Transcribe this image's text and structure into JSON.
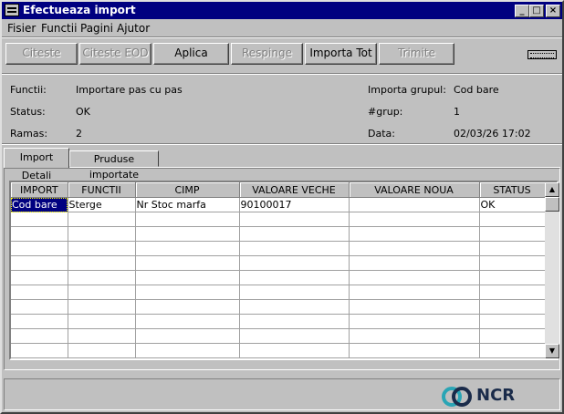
{
  "window": {
    "title": "Efectueaza import",
    "controls": [
      "_",
      "□",
      "×"
    ]
  },
  "menu": [
    {
      "label": "Fisier"
    },
    {
      "label": "Functii"
    },
    {
      "label": "Pagini"
    },
    {
      "label": "Ajutor"
    }
  ],
  "toolbar": {
    "buttons": [
      {
        "label": "Citeste",
        "enabled": false
      },
      {
        "label": "Citeste EOD",
        "enabled": false
      },
      {
        "label": "Aplica",
        "enabled": true
      },
      {
        "label": "Respinge",
        "enabled": false
      },
      {
        "label": "Importa Tot",
        "enabled": true
      },
      {
        "label": "Trimite",
        "enabled": false
      }
    ]
  },
  "info": {
    "functii_label": "Functii:",
    "functii_value": "Importare pas cu pas",
    "status_label": "Status:",
    "status_value": "OK",
    "ramas_label": "Ramas:",
    "ramas_value": "2",
    "grup_label": "Importa grupul:",
    "grup_value": "Cod bare",
    "nrgrup_label": "#grup:",
    "nrgrup_value": "1",
    "data_label": "Data:",
    "data_value": "02/03/26 17:02"
  },
  "tabs": [
    {
      "label": "Import Detali",
      "active": true
    },
    {
      "label": "Pruduse importate",
      "active": false
    }
  ],
  "table": {
    "columns": [
      "IMPORT",
      "FUNCTII",
      "CIMP",
      "VALOARE VECHE",
      "VALOARE NOUA",
      "STATUS"
    ],
    "rows": [
      [
        "Cod bare",
        "Sterge",
        "Nr Stoc marfa",
        "90100017",
        "",
        "OK"
      ]
    ],
    "empty_rows": 10
  },
  "branding": {
    "logo_text": "NCR",
    "logo_icon": "ncr-logo-icon",
    "logo_colors": {
      "teal": "#2aa5b5",
      "navy": "#1a2b4a"
    }
  }
}
